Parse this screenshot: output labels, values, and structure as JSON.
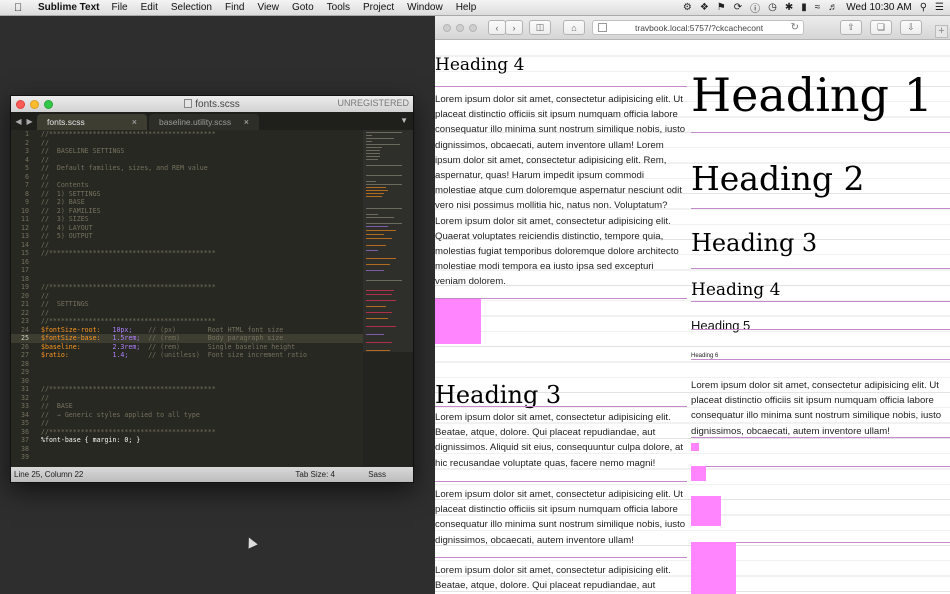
{
  "menubar": {
    "app_name": "Sublime Text",
    "items": [
      "File",
      "Edit",
      "Selection",
      "Find",
      "View",
      "Goto",
      "Tools",
      "Project",
      "Window",
      "Help"
    ],
    "clock": "Wed 10:30 AM"
  },
  "sublime": {
    "window_title": "fonts.scss",
    "license": "UNREGISTERED",
    "tabs": [
      {
        "label": "fonts.scss"
      },
      {
        "label": "baseline.utility.scss"
      }
    ],
    "code_lines": [
      {
        "n": "1",
        "t": "//******************************************"
      },
      {
        "n": "2",
        "t": "//"
      },
      {
        "n": "3",
        "t": "//  BASELINE SETTINGS"
      },
      {
        "n": "4",
        "t": "//"
      },
      {
        "n": "5",
        "t": "//  Default families, sizes, and REM value"
      },
      {
        "n": "6",
        "t": "//"
      },
      {
        "n": "7",
        "t": "//  Contents"
      },
      {
        "n": "8",
        "t": "//  1) SETTINGS"
      },
      {
        "n": "9",
        "t": "//  2) BASE"
      },
      {
        "n": "10",
        "t": "//  2) FAMILIES"
      },
      {
        "n": "11",
        "t": "//  3) SIZES"
      },
      {
        "n": "12",
        "t": "//  4) LAYOUT"
      },
      {
        "n": "13",
        "t": "//  5) OUTPUT"
      },
      {
        "n": "14",
        "t": "//"
      },
      {
        "n": "15",
        "t": "//******************************************"
      },
      {
        "n": "16",
        "t": ""
      },
      {
        "n": "17",
        "t": ""
      },
      {
        "n": "18",
        "t": ""
      },
      {
        "n": "19",
        "t": "//******************************************"
      },
      {
        "n": "20",
        "t": "//"
      },
      {
        "n": "21",
        "t": "//  SETTINGS"
      },
      {
        "n": "22",
        "t": "//"
      },
      {
        "n": "23",
        "t": "//******************************************"
      },
      {
        "n": "24",
        "var": "$fontSize-root:",
        "val": "10px;",
        "c": "// (px)        Root HTML font size"
      },
      {
        "n": "25",
        "var": "$fontSize-base:",
        "val": "1.5rem;",
        "c": "// (rem)       Body paragraph size",
        "current": true
      },
      {
        "n": "26",
        "var": "$baseline:",
        "val": "2.3rem;",
        "c": "// (rem)       Single baseline height"
      },
      {
        "n": "27",
        "var": "$ratio:",
        "val": "1.4;",
        "c": "// (unitless)  Font size increment ratio"
      },
      {
        "n": "28",
        "t": ""
      },
      {
        "n": "29",
        "t": ""
      },
      {
        "n": "30",
        "t": ""
      },
      {
        "n": "31",
        "t": "//******************************************"
      },
      {
        "n": "32",
        "t": "//"
      },
      {
        "n": "33",
        "t": "//  BASE"
      },
      {
        "n": "34",
        "t": "//  → Generic styles applied to all type"
      },
      {
        "n": "35",
        "t": "//"
      },
      {
        "n": "36",
        "t": "//******************************************"
      },
      {
        "n": "37",
        "plain": "%font-base { margin: 0; }"
      },
      {
        "n": "38",
        "t": ""
      },
      {
        "n": "39",
        "t": ""
      }
    ],
    "status": {
      "position": "Line 25, Column 22",
      "tab_size": "Tab Size: 4",
      "syntax": "Sass"
    }
  },
  "browser": {
    "url": "travbook.local:5757/?ckcachecont",
    "left_column": {
      "heading4": "Heading 4",
      "para1": "Lorem ipsum dolor sit amet, consectetur adipisicing elit. Ut placeat distinctio officiis sit ipsum numquam officia labore consequatur illo minima sunt nostrum similique nobis, iusto dignissimos, obcaecati, autem inventore ullam! Lorem ipsum dolor sit amet, consectetur adipisicing elit. Rem, aspernatur, quas! Harum impedit ipsum commodi molestiae atque cum doloremque aspernatur nesciunt odit vero nisi possimus mollitia hic, natus non. Voluptatum? Lorem ipsum dolor sit amet, consectetur adipisicing elit. Quaerat voluptates reiciendis distinctio, tempore quia, molestias fugiat temporibus doloremque dolore architecto molestiae modi tempora ea iusto ipsa sed excepturi veniam dolorem.",
      "heading3": "Heading 3",
      "para2": "Lorem ipsum dolor sit amet, consectetur adipisicing elit. Beatae, atque, dolore. Qui placeat repudiandae, aut dignissimos. Aliquid sit eius, consequuntur culpa dolore, at hic recusandae voluptate quas, facere nemo magni!",
      "para3": "Lorem ipsum dolor sit amet, consectetur adipisicing elit. Ut placeat distinctio officiis sit ipsum numquam officia labore consequatur illo minima sunt nostrum similique nobis, iusto dignissimos, obcaecati, autem inventore ullam!",
      "para4": "Lorem ipsum dolor sit amet, consectetur adipisicing elit. Beatae, atque, dolore. Qui placeat repudiandae, aut"
    },
    "right_column": {
      "h1": "Heading 1",
      "h2": "Heading 2",
      "h3": "Heading 3",
      "h4": "Heading 4",
      "h5": "Heading 5",
      "h6": "Heading 6",
      "para": "Lorem ipsum dolor sit amet, consectetur adipisicing elit. Ut placeat distinctio officiis sit ipsum numquam officia labore consequatur illo minima sunt nostrum similique nobis, iusto dignissimos, obcaecati, autem inventore ullam!"
    }
  },
  "colors": {
    "baseline_accent": "#c38bc9",
    "box_pink": "#ff85ff",
    "editor_bg": "#272822"
  }
}
